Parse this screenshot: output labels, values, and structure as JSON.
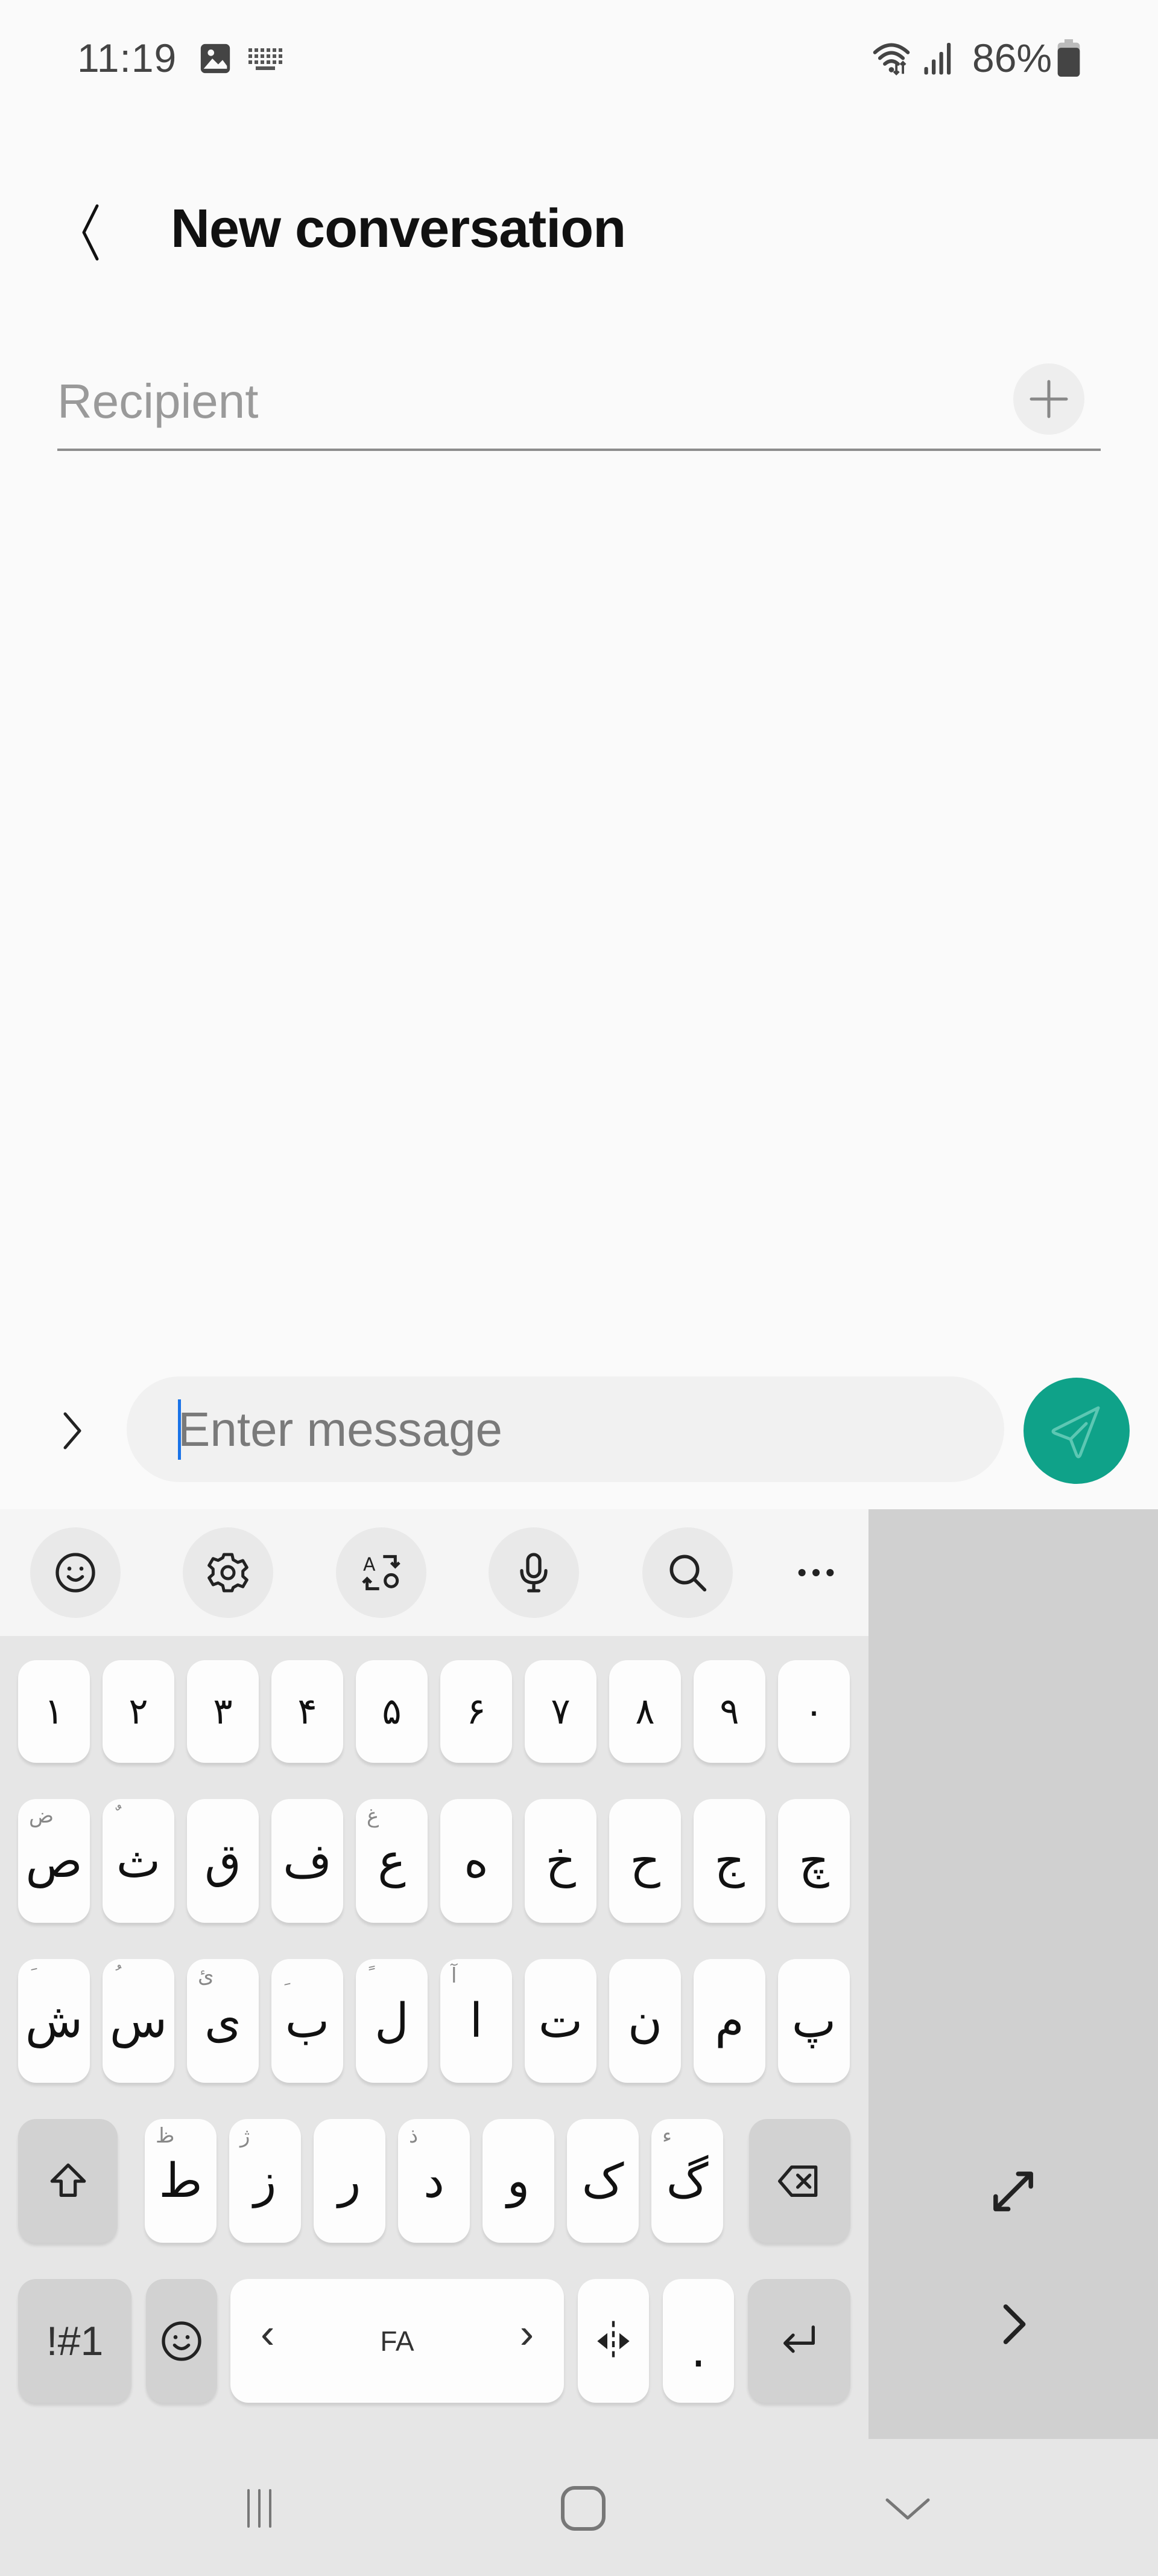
{
  "status_bar": {
    "time": "11:19",
    "notification_icons": [
      "gallery-icon",
      "keyboard-icon"
    ],
    "system_icons": [
      "wifi-icon",
      "signal-icon",
      "battery-icon"
    ],
    "battery_percent": "86%"
  },
  "header": {
    "back_icon": "chevron-left-icon",
    "title": "New conversation"
  },
  "recipient": {
    "placeholder": "Recipient",
    "value": "",
    "add_icon": "plus-icon"
  },
  "composer": {
    "expand_icon": "chevron-right-icon",
    "placeholder": "Enter message",
    "value": "",
    "send_icon": "send-icon",
    "send_color": "#0fa289"
  },
  "keyboard": {
    "language": "FA",
    "toolbar": [
      {
        "name": "emoji",
        "icon": "emoji-icon"
      },
      {
        "name": "settings",
        "icon": "gear-icon"
      },
      {
        "name": "translate",
        "icon": "translate-icon"
      },
      {
        "name": "voice",
        "icon": "microphone-icon"
      },
      {
        "name": "search",
        "icon": "search-icon"
      },
      {
        "name": "more",
        "icon": "more-icon"
      }
    ],
    "number_row": [
      "۱",
      "۲",
      "۳",
      "۴",
      "۵",
      "۶",
      "۷",
      "۸",
      "۹",
      "۰"
    ],
    "row1": [
      {
        "main": "ص",
        "hint": "ض"
      },
      {
        "main": "ث",
        "hint": "ٌ"
      },
      {
        "main": "ق",
        "hint": ""
      },
      {
        "main": "ف",
        "hint": ""
      },
      {
        "main": "ع",
        "hint": "غ"
      },
      {
        "main": "ه",
        "hint": ""
      },
      {
        "main": "خ",
        "hint": ""
      },
      {
        "main": "ح",
        "hint": ""
      },
      {
        "main": "ج",
        "hint": ""
      },
      {
        "main": "چ",
        "hint": ""
      }
    ],
    "row2": [
      {
        "main": "ش",
        "hint": "َ"
      },
      {
        "main": "س",
        "hint": "ُ"
      },
      {
        "main": "ی",
        "hint": "ئ"
      },
      {
        "main": "ب",
        "hint": "ِ"
      },
      {
        "main": "ل",
        "hint": "ً"
      },
      {
        "main": "ا",
        "hint": "آ"
      },
      {
        "main": "ت",
        "hint": ""
      },
      {
        "main": "ن",
        "hint": ""
      },
      {
        "main": "م",
        "hint": ""
      },
      {
        "main": "پ",
        "hint": ""
      }
    ],
    "row3": [
      {
        "main": "ط",
        "hint": "ظ"
      },
      {
        "main": "ز",
        "hint": "ژ"
      },
      {
        "main": "ر",
        "hint": ""
      },
      {
        "main": "د",
        "hint": "ذ"
      },
      {
        "main": "و",
        "hint": ""
      },
      {
        "main": "ک",
        "hint": ""
      },
      {
        "main": "گ",
        "hint": "ء"
      }
    ],
    "shift_icon": "shift-icon",
    "backspace_icon": "backspace-icon",
    "symbols_label": "!#1",
    "emoji_key_icon": "emoji-icon",
    "space_left": "‹",
    "space_right": "›",
    "cursor_key_icon": "cursor-move-icon",
    "period_label": ".",
    "enter_icon": "enter-icon",
    "side_panel": {
      "resize_icon": "resize-icon",
      "next_icon": "chevron-right-icon"
    }
  },
  "nav_bar": [
    {
      "name": "recents",
      "icon": "recents-icon"
    },
    {
      "name": "home",
      "icon": "home-icon"
    },
    {
      "name": "hide-keyboard",
      "icon": "chevron-down-icon"
    }
  ]
}
